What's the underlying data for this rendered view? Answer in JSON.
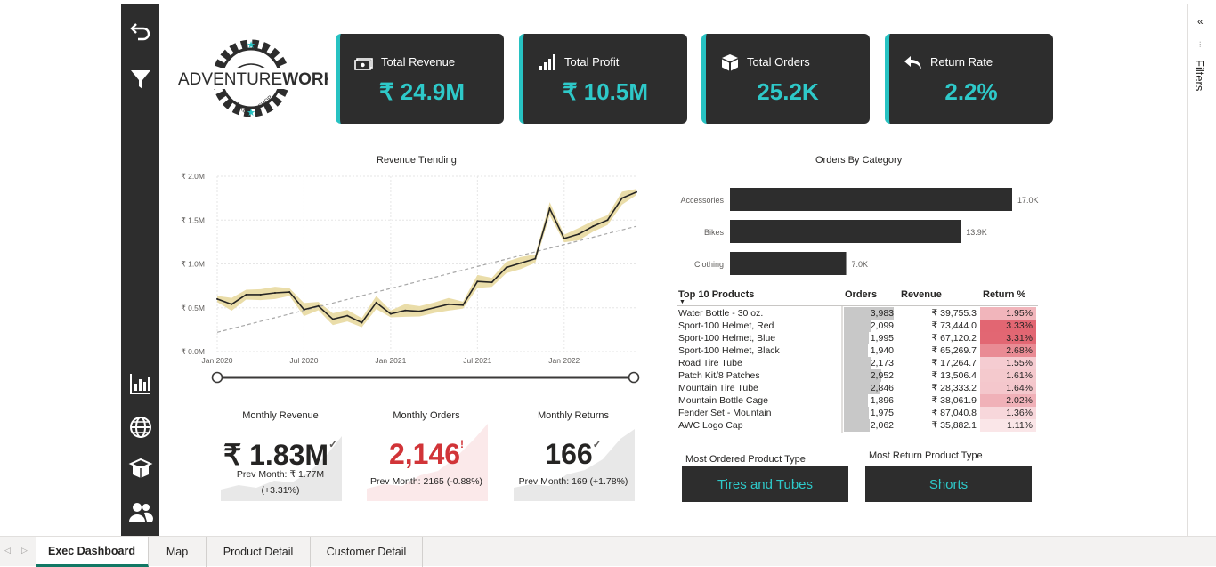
{
  "logo": {
    "brand_part1": "ADVENTURE",
    "brand_part2": "WORKS",
    "sub_left": "BIKE",
    "sub_right": "SHOP"
  },
  "kpis": [
    {
      "label": "Total Revenue",
      "value": "₹ 24.9M",
      "icon": "money-icon"
    },
    {
      "label": "Total Profit",
      "value": "₹ 10.5M",
      "icon": "signal-bars-icon"
    },
    {
      "label": "Total Orders",
      "value": "25.2K",
      "icon": "box-icon"
    },
    {
      "label": "Return Rate",
      "value": "2.2%",
      "icon": "return-arrow-icon"
    }
  ],
  "revenue_chart": {
    "title": "Revenue Trending",
    "y_ticks": [
      "₹ 0.0M",
      "₹ 0.5M",
      "₹ 1.0M",
      "₹ 1.5M",
      "₹ 2.0M"
    ],
    "x_ticks": [
      "Jan 2020",
      "Jul 2020",
      "Jan 2021",
      "Jul 2021",
      "Jan 2022"
    ]
  },
  "chart_data": [
    {
      "type": "line",
      "title": "Revenue Trending",
      "x_start": "Jan 2020",
      "x_interval": "month",
      "ylim": [
        0,
        2.0
      ],
      "y_unit": "₹ M",
      "values": [
        0.6,
        0.54,
        0.65,
        0.65,
        0.67,
        0.68,
        0.48,
        0.52,
        0.37,
        0.41,
        0.33,
        0.56,
        0.43,
        0.47,
        0.46,
        0.5,
        0.54,
        0.53,
        0.8,
        0.79,
        0.96,
        1.01,
        1.06,
        1.63,
        1.29,
        1.34,
        1.43,
        1.5,
        1.75,
        1.82
      ],
      "trend": [
        0.22,
        1.43
      ]
    },
    {
      "type": "bar",
      "title": "Orders By Category",
      "categories": [
        "Accessories",
        "Bikes",
        "Clothing"
      ],
      "values": [
        17.0,
        13.9,
        7.0
      ],
      "labels": [
        "17.0K",
        "13.9K",
        "7.0K"
      ]
    }
  ],
  "category_chart": {
    "title": "Orders By Category"
  },
  "monthly": [
    {
      "title": "Monthly Revenue",
      "value": "₹ 1.83M",
      "status": "✓",
      "prev_line1": "Prev Month: ₹ 1.77M",
      "prev_line2": "(+3.31%)",
      "color": "#252423"
    },
    {
      "title": "Monthly Orders",
      "value": "2,146",
      "status": "!",
      "prev_line1": "Prev Month: 2165 (-0.88%)",
      "color": "#d13438"
    },
    {
      "title": "Monthly Returns",
      "value": "166",
      "status": "✓",
      "prev_line1": "Prev Month: 169 (+1.78%)",
      "color": "#252423"
    }
  ],
  "table": {
    "headers": {
      "product": "Top 10 Products",
      "orders": "Orders",
      "revenue": "Revenue",
      "return": "Return %"
    },
    "max_orders": 3983,
    "rows": [
      {
        "product": "Water Bottle - 30 oz.",
        "orders": "3,983",
        "orders_n": 3983,
        "revenue": "₹ 39,755.3",
        "ret": "1.95%",
        "ret_n": 1.95
      },
      {
        "product": "Sport-100 Helmet, Red",
        "orders": "2,099",
        "orders_n": 2099,
        "revenue": "₹ 73,444.0",
        "ret": "3.33%",
        "ret_n": 3.33
      },
      {
        "product": "Sport-100 Helmet, Blue",
        "orders": "1,995",
        "orders_n": 1995,
        "revenue": "₹ 67,120.2",
        "ret": "3.31%",
        "ret_n": 3.31
      },
      {
        "product": "Sport-100 Helmet, Black",
        "orders": "1,940",
        "orders_n": 1940,
        "revenue": "₹ 65,269.7",
        "ret": "2.68%",
        "ret_n": 2.68
      },
      {
        "product": "Road Tire Tube",
        "orders": "2,173",
        "orders_n": 2173,
        "revenue": "₹ 17,264.7",
        "ret": "1.55%",
        "ret_n": 1.55
      },
      {
        "product": "Patch Kit/8 Patches",
        "orders": "2,952",
        "orders_n": 2952,
        "revenue": "₹ 13,506.4",
        "ret": "1.61%",
        "ret_n": 1.61
      },
      {
        "product": "Mountain Tire Tube",
        "orders": "2,846",
        "orders_n": 2846,
        "revenue": "₹ 28,333.2",
        "ret": "1.64%",
        "ret_n": 1.64
      },
      {
        "product": "Mountain Bottle Cage",
        "orders": "1,896",
        "orders_n": 1896,
        "revenue": "₹ 38,061.9",
        "ret": "2.02%",
        "ret_n": 2.02
      },
      {
        "product": "Fender Set - Mountain",
        "orders": "1,975",
        "orders_n": 1975,
        "revenue": "₹ 87,040.8",
        "ret": "1.36%",
        "ret_n": 1.36
      },
      {
        "product": "AWC Logo Cap",
        "orders": "2,062",
        "orders_n": 2062,
        "revenue": "₹ 35,882.1",
        "ret": "1.11%",
        "ret_n": 1.11
      }
    ]
  },
  "product_types": {
    "most_ordered_label": "Most Ordered Product Type",
    "most_ordered_value": "Tires and Tubes",
    "most_return_label": "Most Return Product Type",
    "most_return_value": "Shorts"
  },
  "filters_label": "Filters",
  "tabs": [
    "Exec Dashboard",
    "Map",
    "Product Detail",
    "Customer Detail"
  ],
  "colors": {
    "accent": "#2ec9c9",
    "dark": "#2d2d2d",
    "negative": "#d13438",
    "band": "#e8d9a0"
  }
}
